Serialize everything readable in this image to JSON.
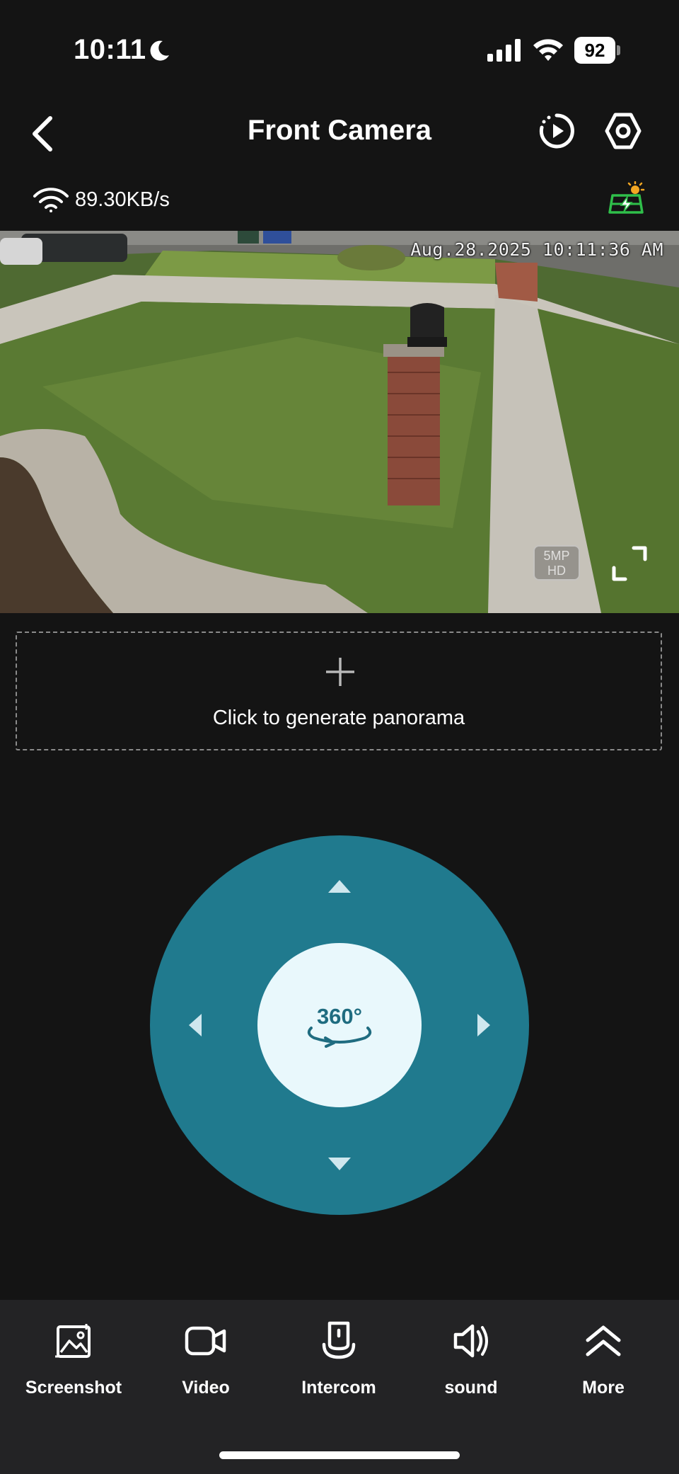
{
  "status_bar": {
    "time": "10:11",
    "battery": "92"
  },
  "header": {
    "title": "Front Camera"
  },
  "info": {
    "network_speed": "89.30KB/s"
  },
  "video": {
    "timestamp": "Aug.28.2025 10:11:36 AM",
    "quality_line1": "5MP",
    "quality_line2": "HD"
  },
  "panorama": {
    "label": "Click to generate panorama"
  },
  "ptz": {
    "center_label": "360°"
  },
  "toolbar": {
    "items": [
      {
        "label": "Screenshot",
        "icon": "screenshot-icon"
      },
      {
        "label": "Video",
        "icon": "video-camera-icon"
      },
      {
        "label": "Intercom",
        "icon": "intercom-icon"
      },
      {
        "label": "sound",
        "icon": "speaker-icon"
      },
      {
        "label": "More",
        "icon": "double-chevron-up-icon"
      }
    ]
  },
  "colors": {
    "background": "#141414",
    "accent_teal": "#207a8e",
    "ptz_center": "#e9f8fc",
    "toolbar_bg": "#232325"
  }
}
